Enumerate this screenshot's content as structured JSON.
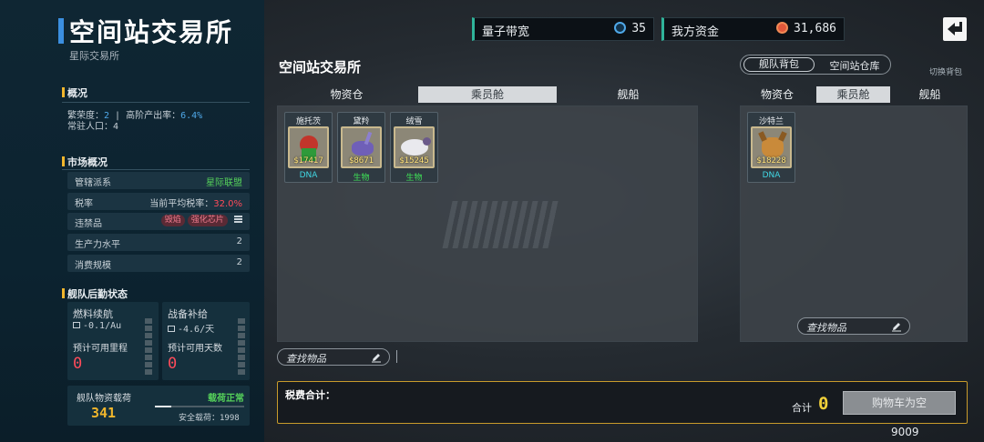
{
  "header": {
    "title": "空间站交易所",
    "subtitle": "星际交易所"
  },
  "hud": {
    "bandwidth": {
      "label": "量子带宽",
      "value": "35",
      "icon": "quantum-icon"
    },
    "funds": {
      "label": "我方资金",
      "value": "31,686",
      "icon": "coin-icon"
    },
    "accent": "#2fb49a"
  },
  "overview": {
    "heading": "概况",
    "line1_a": "繁荣度：",
    "prosperity": "2",
    "line1_b": " | 高阶产出率：",
    "high_output": "6.4%",
    "line2": "常驻人口：4"
  },
  "market": {
    "heading": "市场概况",
    "rows": [
      {
        "label": "管辖派系",
        "value": "星际联盟"
      },
      {
        "label": "税率",
        "value_prefix": "当前平均税率：",
        "value": "32.0%"
      },
      {
        "label": "违禁品",
        "tags": [
          "毁焰",
          "强化芯片"
        ],
        "menu_icon": "list-icon"
      },
      {
        "label": "生产力水平",
        "value": "2"
      },
      {
        "label": "消费规模",
        "value": "2"
      }
    ]
  },
  "logistics": {
    "heading": "舰队后勤状态",
    "fuel": {
      "title": "燃料续航",
      "rate": "-0.1/Au",
      "est_label": "预计可用里程",
      "est_value": "0",
      "icon": "fuel-icon"
    },
    "supply": {
      "title": "战备补给",
      "rate": "-4.6/天",
      "est_label": "预计可用天数",
      "est_value": "0",
      "icon": "supply-icon"
    },
    "cargo": {
      "title": "舰队物资载荷",
      "value": "341",
      "status": "载荷正常",
      "safe_label": "安全载荷：1998"
    }
  },
  "center": {
    "title": "空间站交易所",
    "tabs": [
      "物资仓",
      "乘员舱",
      "舰船"
    ],
    "active_tab": 1,
    "items": [
      {
        "name": "施托茨",
        "price": "$17417",
        "category": "DNA",
        "cat_color": "#41d7e3"
      },
      {
        "name": "黛羚",
        "price": "$8671",
        "category": "生物",
        "cat_color": "#3fe257"
      },
      {
        "name": "绒雪",
        "price": "$15245",
        "category": "生物",
        "cat_color": "#3fe257"
      }
    ],
    "search_placeholder": "查找物品"
  },
  "right": {
    "toggle": [
      "舰队背包",
      "空间站仓库"
    ],
    "switch_label": "切换背包",
    "tabs": [
      "物资仓",
      "乘员舱",
      "舰船"
    ],
    "active_tab": 1,
    "items": [
      {
        "name": "沙特兰",
        "price": "$18228",
        "category": "DNA",
        "cat_color": "#41d7e3"
      }
    ],
    "search_placeholder": "查找物品"
  },
  "cost": {
    "label": "税费合计：",
    "total_label": "合计",
    "total_value": "0",
    "cart_button": "购物车为空",
    "footer_number": "9009"
  }
}
